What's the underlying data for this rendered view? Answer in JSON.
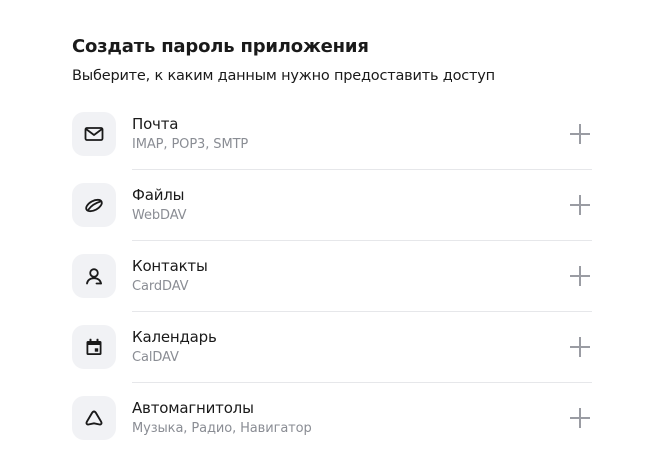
{
  "page": {
    "title": "Создать пароль приложения",
    "subtitle": "Выберите, к каким данным нужно предоставить доступ"
  },
  "items": [
    {
      "title": "Почта",
      "subtitle": "IMAP, POP3, SMTP",
      "icon": "envelope-icon"
    },
    {
      "title": "Файлы",
      "subtitle": "WebDAV",
      "icon": "disk-icon"
    },
    {
      "title": "Контакты",
      "subtitle": "CardDAV",
      "icon": "contact-icon"
    },
    {
      "title": "Календарь",
      "subtitle": "CalDAV",
      "icon": "calendar-icon"
    },
    {
      "title": "Автомагнитолы",
      "subtitle": "Музыка, Радио, Навигатор",
      "icon": "navigation-icon"
    }
  ],
  "colors": {
    "icon_bg": "#f1f2f5",
    "subtitle_text": "#8a8d94",
    "plus": "#9a9ca3",
    "divider": "#e6e7ea"
  }
}
